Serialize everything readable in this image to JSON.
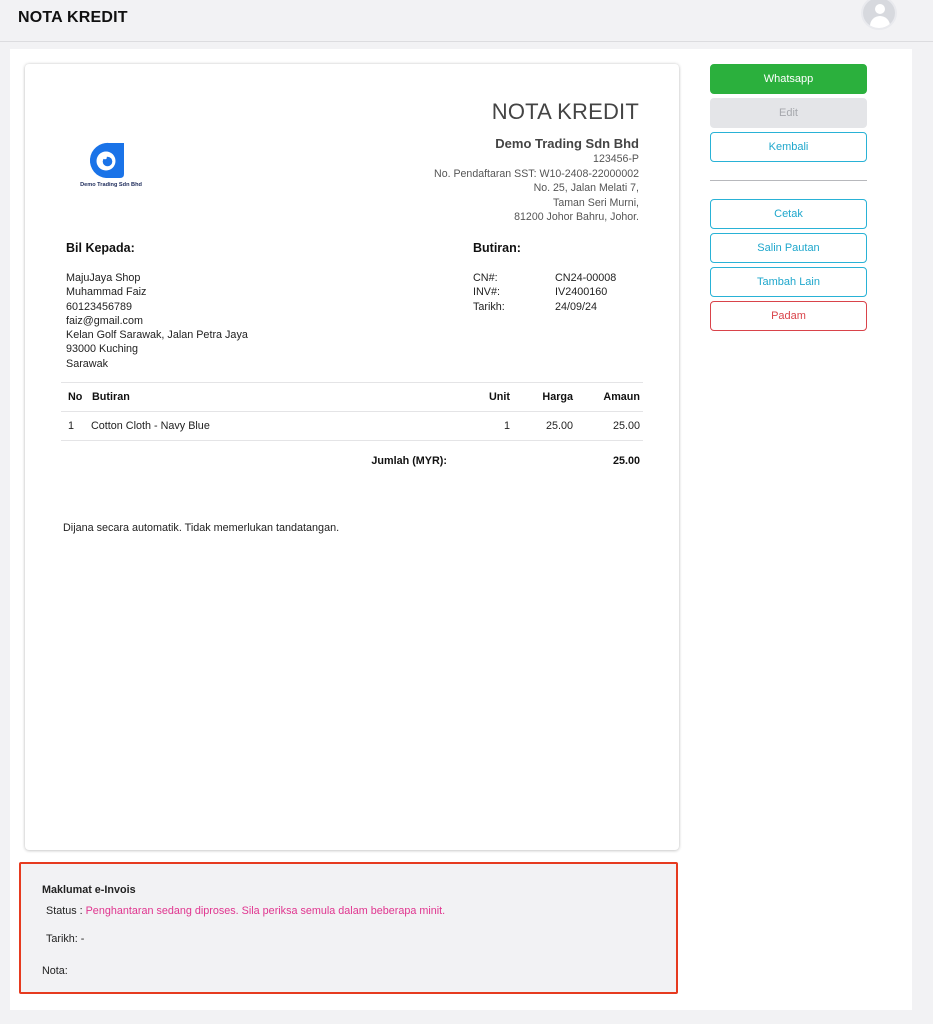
{
  "app": {
    "title": "NOTA KREDIT"
  },
  "document": {
    "title": "NOTA KREDIT",
    "logo_text": "Demo Trading Sdn Bhd",
    "company": {
      "name": "Demo Trading Sdn Bhd",
      "reg_no": "123456-P",
      "sst_no": "No. Pendaftaran SST: W10-2408-22000002",
      "address_line1": "No. 25, Jalan Melati 7,",
      "address_line2": "Taman Seri Murni,",
      "address_line3": "81200 Johor Bahru, Johor."
    },
    "bill_to": {
      "heading": "Bil Kepada:",
      "shop": "MajuJaya Shop",
      "name": "Muhammad Faiz",
      "phone": "60123456789",
      "email": "faiz@gmail.com",
      "address_line1": "Kelan Golf Sarawak, Jalan Petra Jaya",
      "address_line2": "93000 Kuching",
      "address_line3": "Sarawak"
    },
    "details": {
      "heading": "Butiran:",
      "cn_label": "CN#:",
      "cn_value": "CN24-00008",
      "inv_label": "INV#:",
      "inv_value": "IV2400160",
      "date_label": "Tarikh:",
      "date_value": "24/09/24"
    },
    "items_table": {
      "headers": {
        "no": "No",
        "desc": "Butiran",
        "unit": "Unit",
        "price": "Harga",
        "amount": "Amaun"
      },
      "rows": [
        {
          "no": "1",
          "desc": "Cotton Cloth - Navy Blue",
          "unit": "1",
          "price": "25.00",
          "amount": "25.00"
        }
      ],
      "total_label": "Jumlah (MYR):",
      "total_value": "25.00"
    },
    "footer_note": "Dijana secara automatik. Tidak memerlukan tandatangan."
  },
  "einvoice": {
    "title": "Maklumat e-Invois",
    "status_label": "Status : ",
    "status_value": "Penghantaran sedang diproses. Sila periksa semula dalam beberapa minit.",
    "date_text": "Tarikh: -",
    "nota_text": "Nota:"
  },
  "actions": {
    "whatsapp": "Whatsapp",
    "edit": "Edit",
    "kembali": "Kembali",
    "cetak": "Cetak",
    "salin_pautan": "Salin Pautan",
    "tambah_lain": "Tambah Lain",
    "padam": "Padam"
  },
  "colors": {
    "whatsapp_green": "#2bb03d",
    "outline_blue": "#1fa7cc",
    "danger_red": "#d9434a",
    "status_pink": "#e0358f",
    "highlight_red": "#e63a1f",
    "logo_blue": "#1a73e8"
  },
  "icons": {
    "avatar": "user-avatar-icon",
    "logo": "company-logo"
  }
}
